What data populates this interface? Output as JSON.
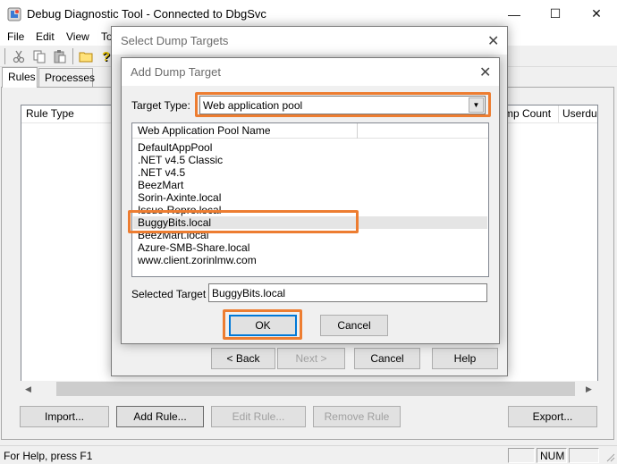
{
  "window": {
    "title": "Debug Diagnostic Tool - Connected to DbgSvc",
    "minimize": "—",
    "maximize": "☐",
    "close": "✕"
  },
  "menu": [
    "File",
    "Edit",
    "View",
    "To"
  ],
  "toolbar_icons": [
    "cut-icon",
    "copy-icon",
    "paste-icon",
    "open-folder-icon",
    "help-icon"
  ],
  "tabs": [
    "Rules",
    "Processes"
  ],
  "rules_list": {
    "columns": [
      "Rule Type",
      "mp Count",
      "Userdu"
    ]
  },
  "buttons": {
    "import": "Import...",
    "add_rule": "Add Rule...",
    "edit_rule": "Edit Rule...",
    "remove_rule": "Remove Rule",
    "export": "Export..."
  },
  "status": {
    "help_text": "For Help, press F1",
    "num": "NUM"
  },
  "select_dump_targets": {
    "title": "Select Dump Targets",
    "close": "✕",
    "back": "< Back",
    "next": "Next >",
    "cancel": "Cancel",
    "help": "Help"
  },
  "add_dump_target": {
    "title": "Add Dump Target",
    "close": "✕",
    "target_type_label": "Target Type:",
    "target_type_value": "Web application pool",
    "list_header": "Web Application Pool Name",
    "pools": [
      "DefaultAppPool",
      ".NET v4.5 Classic",
      ".NET v4.5",
      "BeezMart",
      "Sorin-Axinte.local",
      "Issue-Repro.local",
      "BuggyBits.local",
      "BeezMart.local",
      "Azure-SMB-Share.local",
      "www.client.zorinlmw.com"
    ],
    "selected_label": "Selected Target",
    "selected_value": "BuggyBits.local",
    "ok": "OK",
    "cancel": "Cancel"
  },
  "highlight_color": "#ed7d31"
}
